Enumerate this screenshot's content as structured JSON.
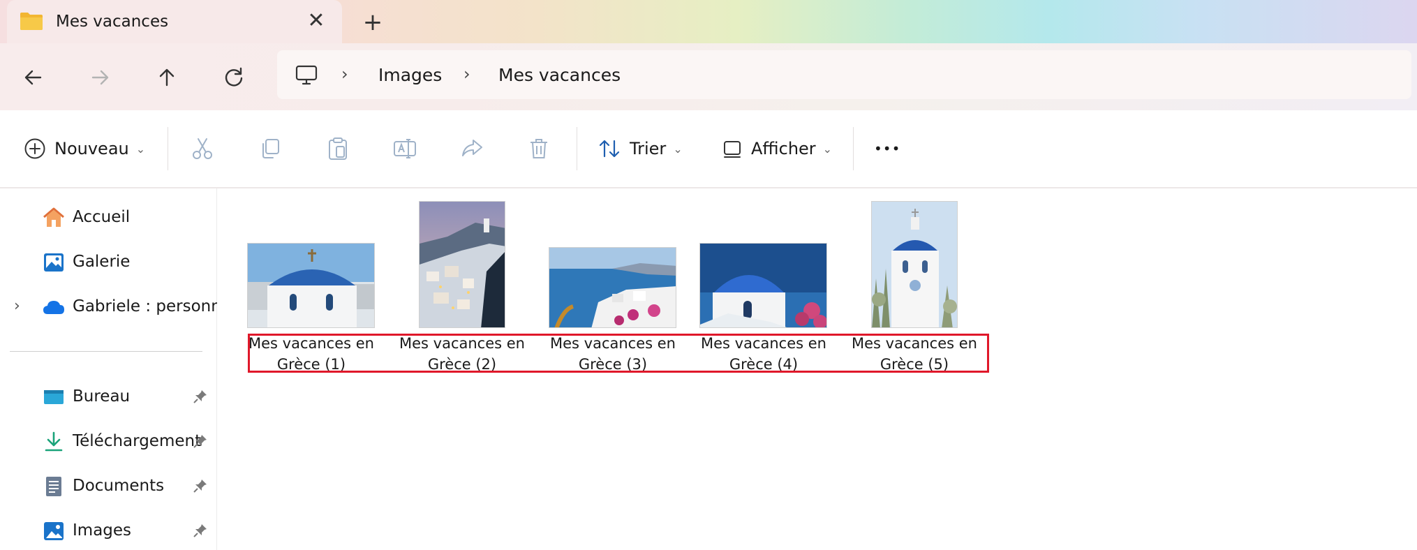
{
  "tab": {
    "title": "Mes vacances",
    "close_glyph": "✕",
    "new_tab_glyph": "+"
  },
  "nav": {
    "back_icon": "arrow-left-icon",
    "forward_icon": "arrow-right-icon",
    "up_icon": "arrow-up-icon",
    "refresh_icon": "refresh-icon",
    "breadcrumb": [
      "Images",
      "Mes vacances"
    ],
    "chevron": "›"
  },
  "command_bar": {
    "new_label": "Nouveau",
    "sort_label": "Trier",
    "view_label": "Afficher",
    "more_glyph": "•••",
    "dropdown_glyph": "⌄"
  },
  "sidebar": {
    "items": [
      {
        "label": "Accueil",
        "icon": "home-icon"
      },
      {
        "label": "Galerie",
        "icon": "gallery-icon"
      },
      {
        "label": "Gabriele : personne",
        "icon": "onedrive-cloud-icon",
        "expander": "›"
      }
    ],
    "pinned": [
      {
        "label": "Bureau",
        "icon": "desktop-icon"
      },
      {
        "label": "Téléchargement",
        "icon": "download-icon"
      },
      {
        "label": "Documents",
        "icon": "documents-icon"
      },
      {
        "label": "Images",
        "icon": "images-icon"
      }
    ]
  },
  "files": [
    {
      "line1": "Mes vacances en",
      "line2": "Grèce (1)"
    },
    {
      "line1": "Mes vacances en",
      "line2": "Grèce (2)"
    },
    {
      "line1": "Mes vacances en",
      "line2": "Grèce (3)"
    },
    {
      "line1": "Mes vacances en",
      "line2": "Grèce (4)"
    },
    {
      "line1": "Mes vacances en",
      "line2": "Grèce (5)"
    }
  ],
  "colors": {
    "highlight": "#e0182a",
    "dome_blue": "#1f5fb0",
    "folder_yellow": "#f2b632"
  }
}
